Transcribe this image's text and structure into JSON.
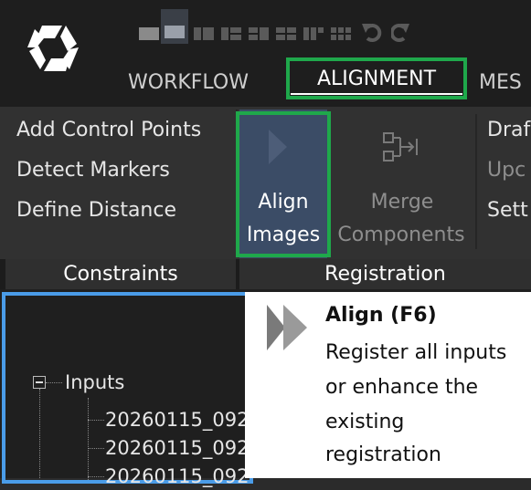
{
  "toolbar": {
    "icons": [
      "layout-icon-1",
      "layout-icon-2",
      "layout-icon-3",
      "layout-icon-4",
      "layout-icon-5",
      "layout-icon-6",
      "layout-icon-7",
      "layout-icon-8",
      "undo-icon",
      "redo-icon"
    ]
  },
  "tabs": {
    "workflow": "WORKFLOW",
    "alignment": "ALIGNMENT",
    "mesh": "MES"
  },
  "constraints": {
    "items": [
      "Add Control Points",
      "Detect Markers",
      "Define Distance"
    ],
    "group_label": "Constraints"
  },
  "registration": {
    "align_label_line1": "Align",
    "align_label_line2": "Images",
    "merge_label_line1": "Merge",
    "merge_label_line2": "Components",
    "right_items": [
      "Draf",
      "Upc",
      "Sett"
    ],
    "group_label": "Registration"
  },
  "tree": {
    "root": "Inputs",
    "items": [
      "20260115_092",
      "20260115_092",
      "20260115_092"
    ]
  },
  "tooltip": {
    "title": "Align (F6)",
    "lines": [
      "Register all inputs",
      "or enhance the",
      "existing",
      "registration"
    ]
  },
  "colors": {
    "highlight": "#1fa84b",
    "selection_blue": "#4a9ce8",
    "align_button_bg": "#3b4c66"
  }
}
